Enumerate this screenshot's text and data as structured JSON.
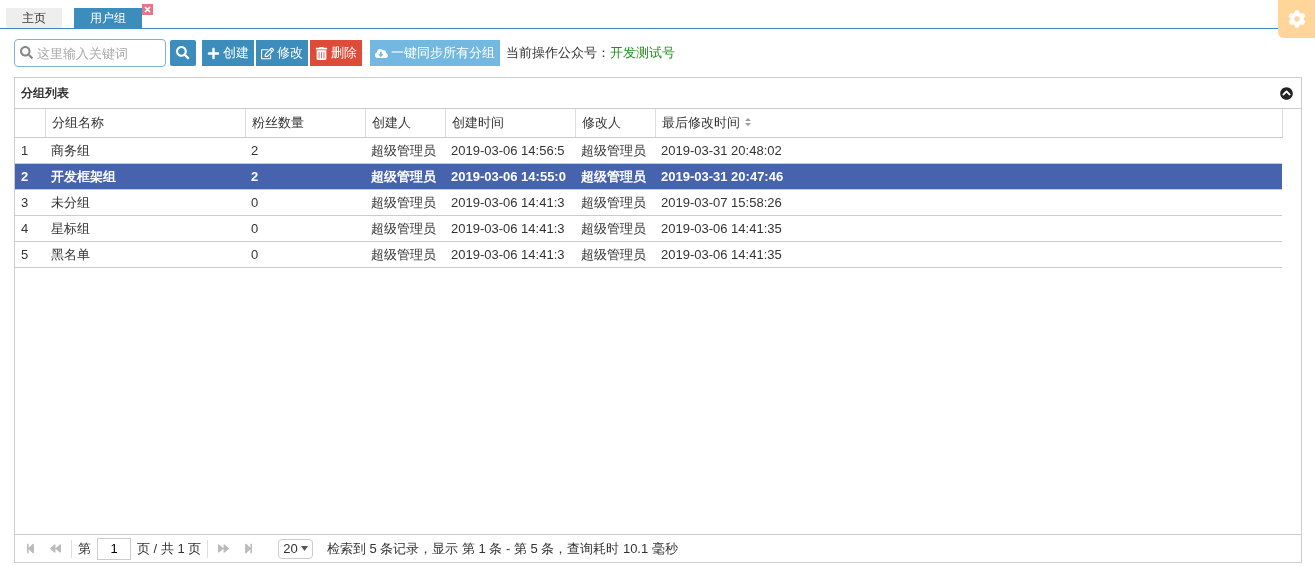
{
  "tabs": [
    {
      "label": "主页",
      "selected": false,
      "closable": false
    },
    {
      "label": "用户组",
      "selected": true,
      "closable": true
    }
  ],
  "toolbar": {
    "search": {
      "placeholder": "这里输入关键词"
    },
    "buttons": [
      {
        "label": "创建",
        "kind": "create"
      },
      {
        "label": "修改",
        "kind": "edit"
      },
      {
        "label": "删除",
        "kind": "delete"
      },
      {
        "label": "一键同步所有分组",
        "kind": "sync"
      }
    ],
    "account_label": "当前操作公众号：",
    "account_value": "开发测试号"
  },
  "panel": {
    "title": "分组列表",
    "columns": [
      {
        "label": "分组名称",
        "sorted": false
      },
      {
        "label": "粉丝数量",
        "sorted": false
      },
      {
        "label": "创建人",
        "sorted": false
      },
      {
        "label": "创建时间",
        "sorted": false
      },
      {
        "label": "修改人",
        "sorted": false
      },
      {
        "label": "最后修改时间",
        "sorted": true
      }
    ],
    "rows": [
      {
        "index": "1",
        "selected": false,
        "cells": [
          "商务组",
          "2",
          "超级管理员",
          "2019-03-06 14:56:5",
          "超级管理员",
          "2019-03-31 20:48:02"
        ]
      },
      {
        "index": "2",
        "selected": true,
        "cells": [
          "开发框架组",
          "2",
          "超级管理员",
          "2019-03-06 14:55:0",
          "超级管理员",
          "2019-03-31 20:47:46"
        ]
      },
      {
        "index": "3",
        "selected": false,
        "cells": [
          "未分组",
          "0",
          "超级管理员",
          "2019-03-06 14:41:3",
          "超级管理员",
          "2019-03-07 15:58:26"
        ]
      },
      {
        "index": "4",
        "selected": false,
        "cells": [
          "星标组",
          "0",
          "超级管理员",
          "2019-03-06 14:41:3",
          "超级管理员",
          "2019-03-06 14:41:35"
        ]
      },
      {
        "index": "5",
        "selected": false,
        "cells": [
          "黑名单",
          "0",
          "超级管理员",
          "2019-03-06 14:41:3",
          "超级管理员",
          "2019-03-06 14:41:35"
        ]
      }
    ],
    "pager": {
      "page_prefix": "第",
      "page": "1",
      "page_suffix": "页 / 共 1 页",
      "page_size": "20",
      "info": "检索到 5 条记录，显示 第 1 条 - 第 5 条，查询耗时 10.1 毫秒"
    }
  }
}
